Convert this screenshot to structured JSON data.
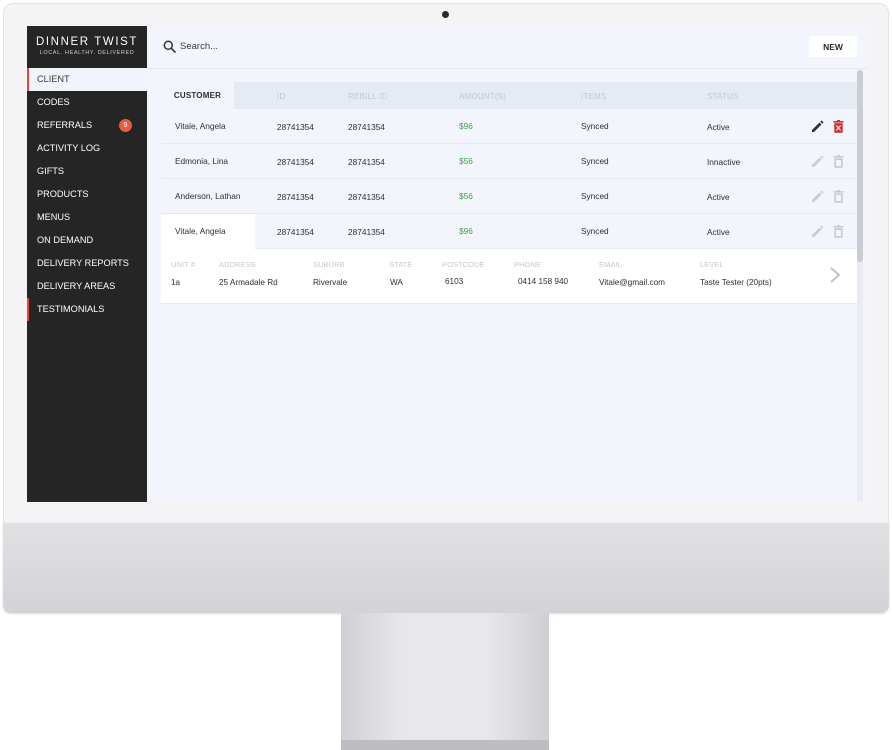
{
  "brand": {
    "title": "DINNER TWIST",
    "tagline": "LOCAL. HEALTHY. DELIVERED"
  },
  "sidebar": {
    "items": [
      {
        "label": "CLIENT"
      },
      {
        "label": "CODES"
      },
      {
        "label": "REFERRALS",
        "badge": "9"
      },
      {
        "label": "ACTIVITY LOG"
      },
      {
        "label": "GIFTS"
      },
      {
        "label": "PRODUCTS"
      },
      {
        "label": "MENUS"
      },
      {
        "label": "ON DEMAND"
      },
      {
        "label": "DELIVERY REPORTS"
      },
      {
        "label": "DELIVERY AREAS"
      },
      {
        "label": "TESTIMONIALS"
      }
    ]
  },
  "search": {
    "placeholder": "Search..."
  },
  "toolbar": {
    "new_label": "NEW"
  },
  "table": {
    "headers": [
      "CUSTOMER",
      "ID",
      "REBILL ID",
      "AMOUNT(S)",
      "ITEMS",
      "STATUS"
    ],
    "rows": [
      {
        "name": "Vitale, Angela",
        "id": "28741354",
        "rebill": "28741354",
        "amount": "$96",
        "items": "Synced",
        "status": "Active"
      },
      {
        "name": "Edmonia, Lina",
        "id": "28741354",
        "rebill": "28741354",
        "amount": "$56",
        "items": "Synced",
        "status": "Innactive"
      },
      {
        "name": "Anderson, Lathan",
        "id": "28741354",
        "rebill": "28741354",
        "amount": "$56",
        "items": "Synced",
        "status": "Active"
      },
      {
        "name": "Vitale, Angela",
        "id": "28741354",
        "rebill": "28741354",
        "amount": "$96",
        "items": "Synced",
        "status": "Active"
      }
    ]
  },
  "detail": {
    "headers": [
      "UNIT #",
      "ADDRESS",
      "SUBURB",
      "STATE",
      "POSTCODE",
      "PHONE",
      "EMAIL",
      "LEVEL"
    ],
    "values": [
      "1a",
      "25 Armadale Rd",
      "Rivervale",
      "WA",
      "6103",
      "0414 158 940",
      "Vitale@gmail.com",
      "Taste Tester (20pts)"
    ]
  },
  "colors": {
    "sidebar_bg": "#252525",
    "accent_red": "#e8423a",
    "badge": "#ec5b3c",
    "amount_green": "#43a047",
    "delete_red": "#d32f2f",
    "disabled_icon": "#c9ccd2"
  },
  "icons": {
    "search": "search-icon",
    "edit": "pencil-icon",
    "delete": "trash-icon",
    "chevron": "chevron-right-icon"
  }
}
